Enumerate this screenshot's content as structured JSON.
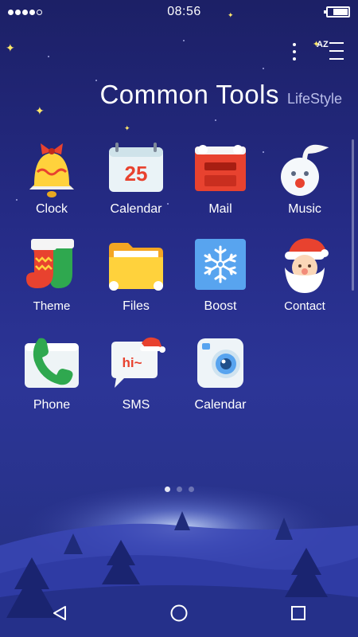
{
  "status_bar": {
    "time": "08:56",
    "signal_bars": 4,
    "signal_max": 5,
    "battery_icon": "battery-icon"
  },
  "header": {
    "title": "Common Tools",
    "subtitle": "LifeStyle",
    "menu_icon": "more-vert-icon",
    "sort_icon": "sort-az-icon",
    "sort_letters": "AZ"
  },
  "apps": [
    {
      "label": "Clock",
      "icon": "bell-clock-icon"
    },
    {
      "label": "Calendar",
      "icon": "calendar-icon",
      "icon_text": "25"
    },
    {
      "label": "Mail",
      "icon": "mailbox-icon"
    },
    {
      "label": "Music",
      "icon": "music-snowman-icon"
    },
    {
      "label": "Theme",
      "icon": "stocking-icon"
    },
    {
      "label": "Files",
      "icon": "folder-icon"
    },
    {
      "label": "Boost",
      "icon": "snowflake-icon"
    },
    {
      "label": "Contact",
      "icon": "santa-icon"
    },
    {
      "label": "Phone",
      "icon": "phone-icon"
    },
    {
      "label": "SMS",
      "icon": "sms-bubble-icon",
      "icon_text": "hi~"
    },
    {
      "label": "Calendar",
      "icon": "camera-icon"
    }
  ],
  "pager": {
    "pages": 3,
    "active": 1
  },
  "nav": {
    "back": "back-icon",
    "home": "home-icon",
    "recents": "recents-icon"
  },
  "colors": {
    "background_top": "#1c2066",
    "background_bottom": "#24307f",
    "accent_red": "#e8422f",
    "accent_yellow": "#ffd23c",
    "accent_green": "#2fa84f",
    "accent_blue": "#58a4ef"
  }
}
